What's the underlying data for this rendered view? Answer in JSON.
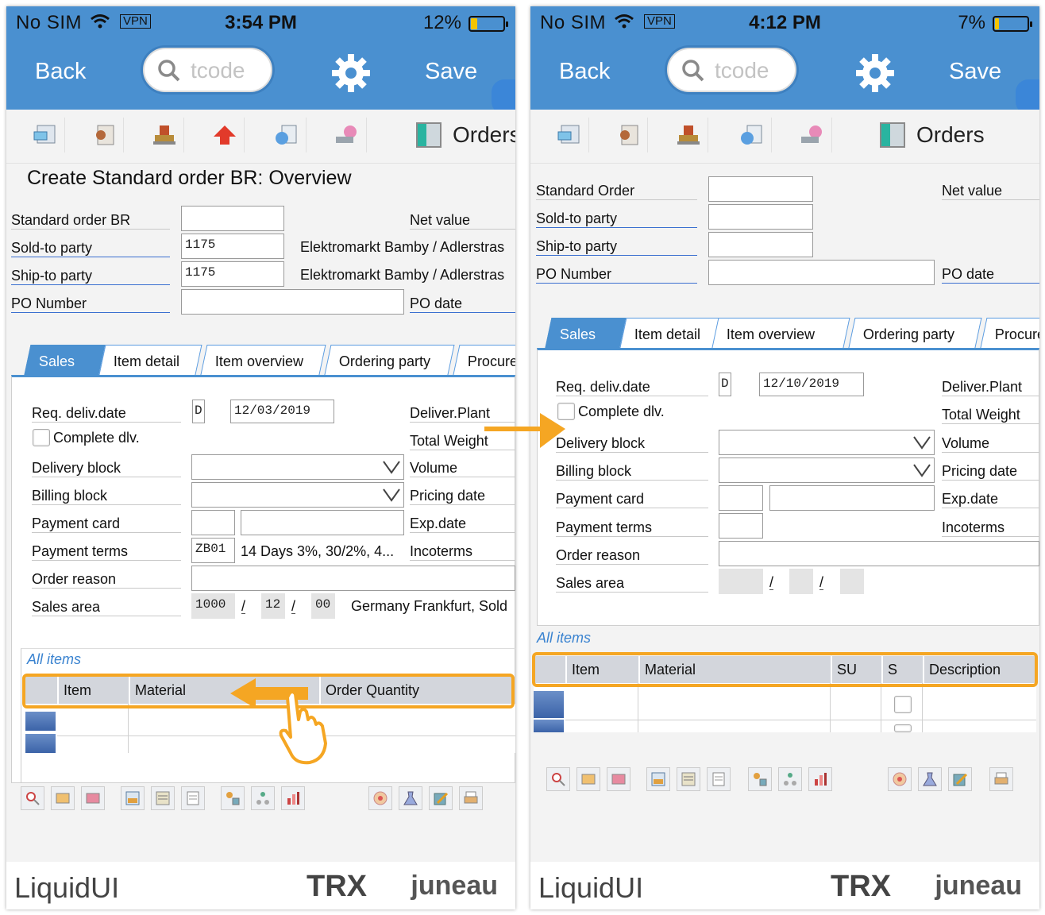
{
  "left": {
    "status": {
      "carrier": "No SIM",
      "vpn": "VPN",
      "time": "3:54 PM",
      "battery": "12%",
      "battery_level": 0.12
    },
    "nav": {
      "back": "Back",
      "search_placeholder": "tcode",
      "save": "Save"
    },
    "toolbar": {
      "orders": "Orders"
    },
    "title": "Create Standard order BR: Overview",
    "header": {
      "order_label": "Standard order BR",
      "order_value": "",
      "net_value_label": "Net value",
      "sold_to_label": "Sold-to party",
      "sold_to_value": "1175",
      "sold_to_name": "Elektromarkt Bamby / Adlerstras",
      "ship_to_label": "Ship-to party",
      "ship_to_value": "1175",
      "ship_to_name": "Elektromarkt Bamby / Adlerstras",
      "po_number_label": "PO Number",
      "po_number_value": "",
      "po_date_label": "PO date"
    },
    "tabs": [
      "Sales",
      "Item detail",
      "Item overview",
      "Ordering party",
      "Procuren"
    ],
    "sales": {
      "req_deliv_label": "Req. deliv.date",
      "req_deliv_type": "D",
      "req_deliv_value": "12/03/2019",
      "complete_dlv_label": "Complete dlv.",
      "delivery_block_label": "Delivery block",
      "billing_block_label": "Billing block",
      "payment_card_label": "Payment card",
      "payment_terms_label": "Payment terms",
      "payment_terms_value": "ZB01",
      "payment_terms_text": "14 Days 3%, 30/2%, 4...",
      "order_reason_label": "Order reason",
      "sales_area_label": "Sales area",
      "sales_org": "1000",
      "dist_channel": "12",
      "division": "00",
      "sales_area_text": "Germany Frankfurt, Sold",
      "slash": "/",
      "deliver_plant_label": "Deliver.Plant",
      "total_weight_label": "Total Weight",
      "volume_label": "Volume",
      "pricing_date_label": "Pricing date",
      "exp_date_label": "Exp.date",
      "incoterms_label": "Incoterms"
    },
    "grid": {
      "title": "All items",
      "columns": [
        "Item",
        "Material",
        "Order Quantity"
      ]
    }
  },
  "right": {
    "status": {
      "carrier": "No SIM",
      "vpn": "VPN",
      "time": "4:12 PM",
      "battery": "7%",
      "battery_level": 0.07
    },
    "nav": {
      "back": "Back",
      "search_placeholder": "tcode",
      "save": "Save"
    },
    "toolbar": {
      "orders": "Orders"
    },
    "header": {
      "order_label": "Standard Order",
      "net_value_label": "Net value",
      "sold_to_label": "Sold-to party",
      "ship_to_label": "Ship-to party",
      "po_number_label": "PO Number",
      "po_date_label": "PO date"
    },
    "tabs": [
      "Sales",
      "Item detail",
      "Item overview",
      "Ordering party",
      "Procure"
    ],
    "sales": {
      "req_deliv_label": "Req. deliv.date",
      "req_deliv_type": "D",
      "req_deliv_value": "12/10/2019",
      "complete_dlv_label": "Complete dlv.",
      "delivery_block_label": "Delivery block",
      "billing_block_label": "Billing block",
      "payment_card_label": "Payment card",
      "payment_terms_label": "Payment terms",
      "order_reason_label": "Order reason",
      "sales_area_label": "Sales area",
      "slash": "/",
      "deliver_plant_label": "Deliver.Plant",
      "total_weight_label": "Total Weight",
      "volume_label": "Volume",
      "pricing_date_label": "Pricing date",
      "exp_date_label": "Exp.date",
      "incoterms_label": "Incoterms"
    },
    "grid": {
      "title": "All items",
      "columns": [
        "Item",
        "Material",
        "SU",
        "S",
        "Description"
      ]
    }
  },
  "footer": {
    "brand": "LiquidUI",
    "product": "TRX",
    "server": "juneau"
  },
  "colors": {
    "header_blue": "#4a90d0",
    "highlight_orange": "#f5a623",
    "link_blue": "#3a83d0"
  }
}
